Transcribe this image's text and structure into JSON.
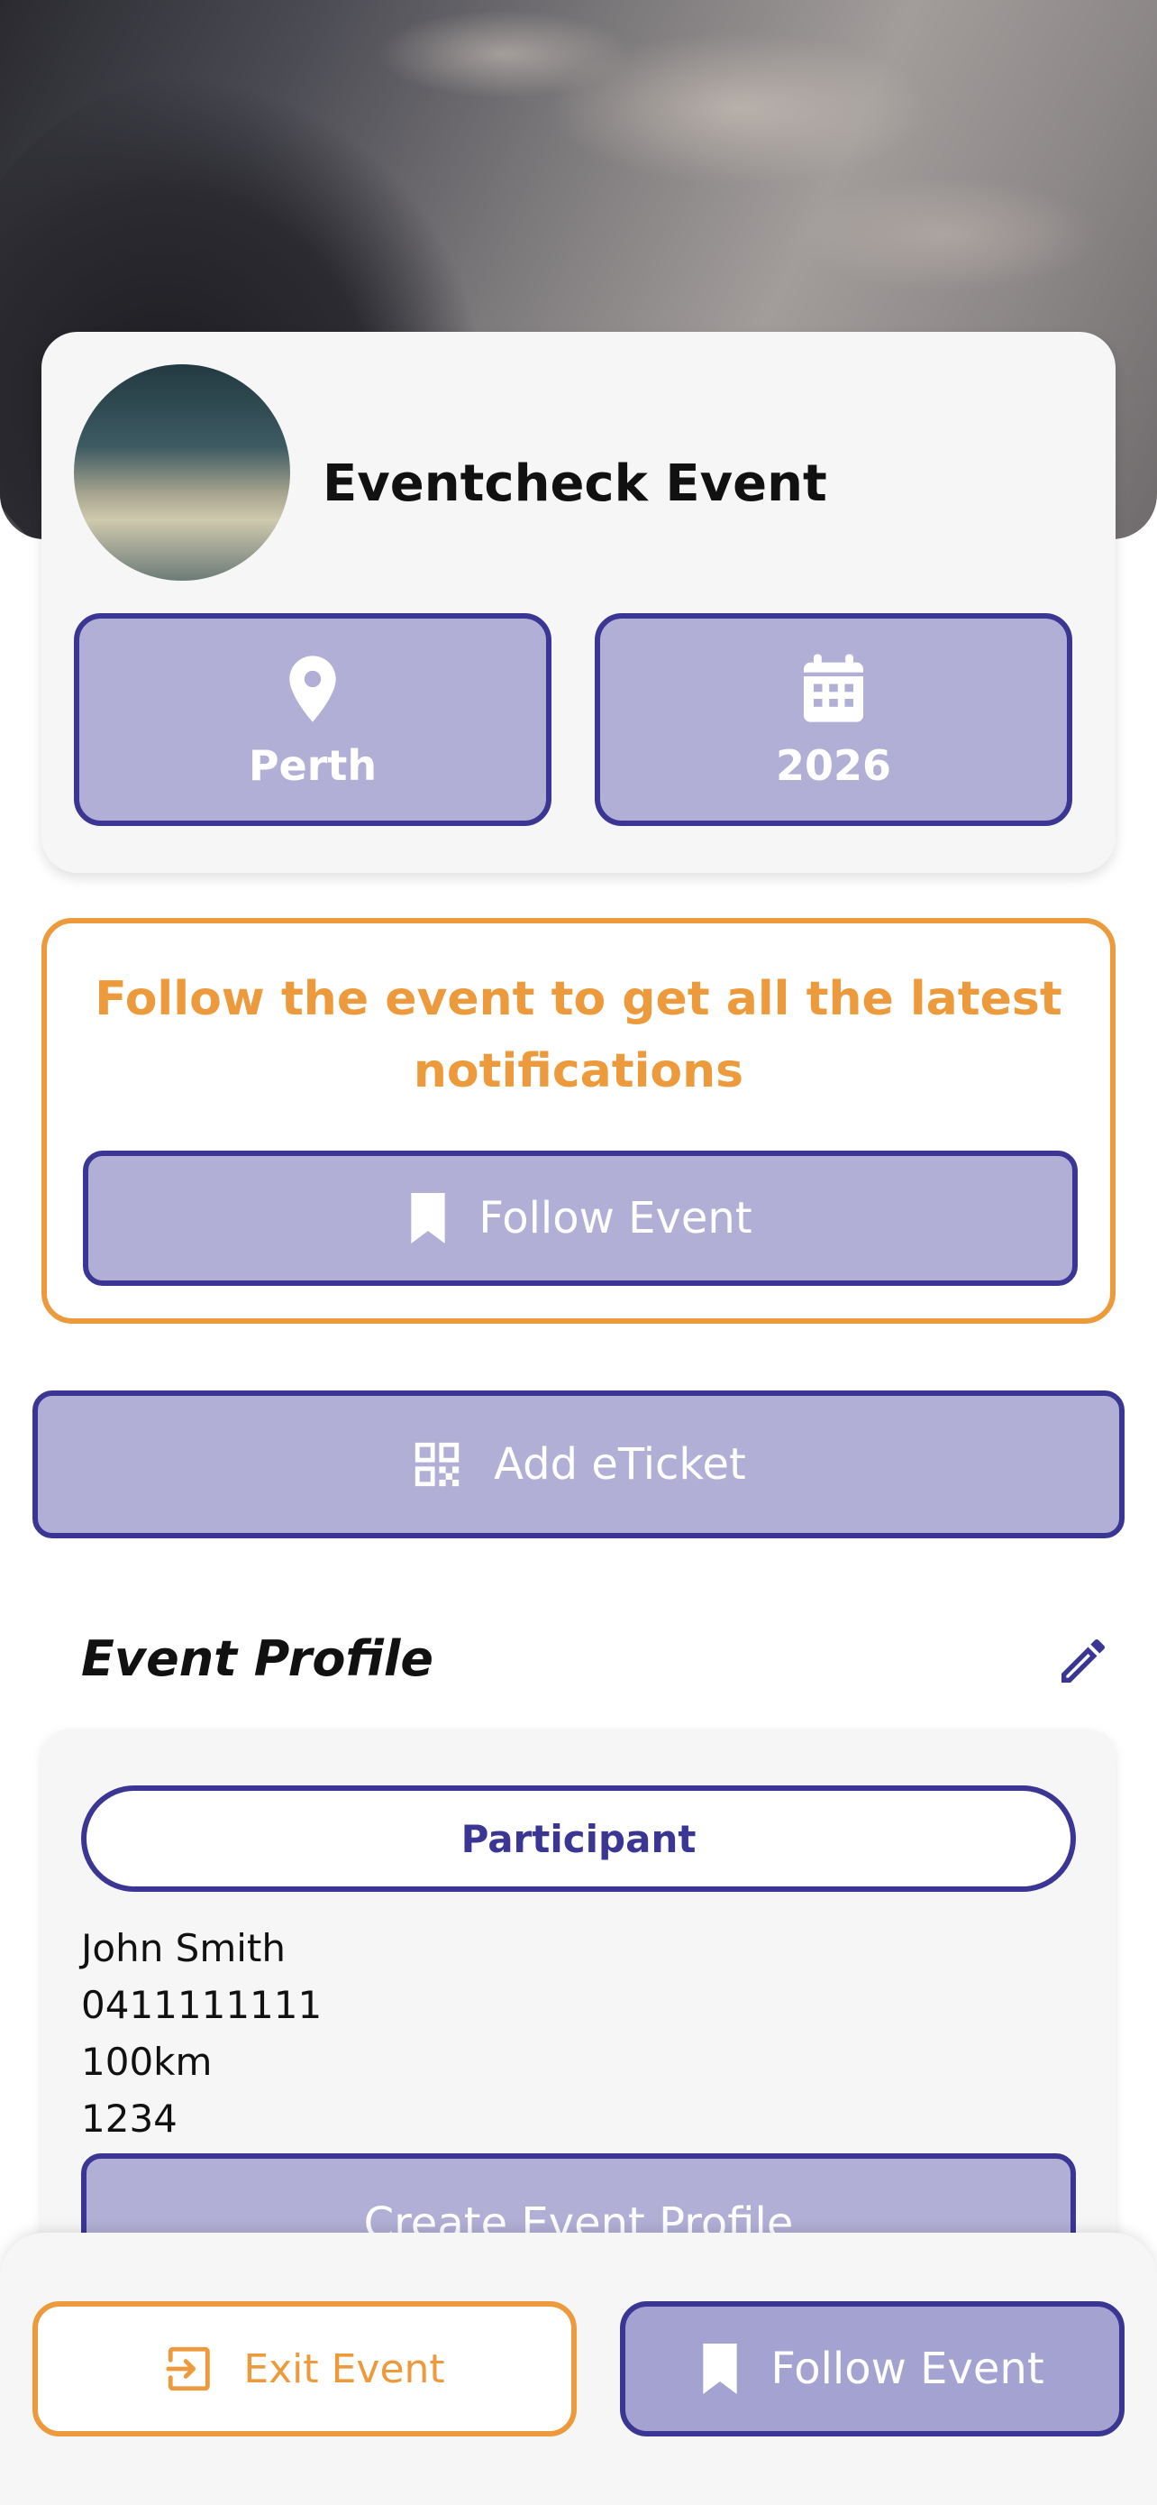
{
  "event": {
    "name": "Eventcheck Event",
    "location": "Perth",
    "year": "2026"
  },
  "follow_card": {
    "message": "Follow the event to get all the latest notifications",
    "button_label": "Follow Event"
  },
  "add_ticket": {
    "label": "Add eTicket"
  },
  "profile": {
    "section_title": "Event Profile",
    "role": "Participant",
    "name": "John Smith",
    "phone": "0411111111",
    "distance": "100km",
    "number": "1234",
    "create_button": "Create Event Profile"
  },
  "bottom_bar": {
    "exit_label": "Exit Event",
    "follow_label": "Follow Event"
  },
  "colors": {
    "accent_purple": "#3b3694",
    "button_fill": "#b1afd5",
    "accent_orange": "#ec9a3c"
  }
}
